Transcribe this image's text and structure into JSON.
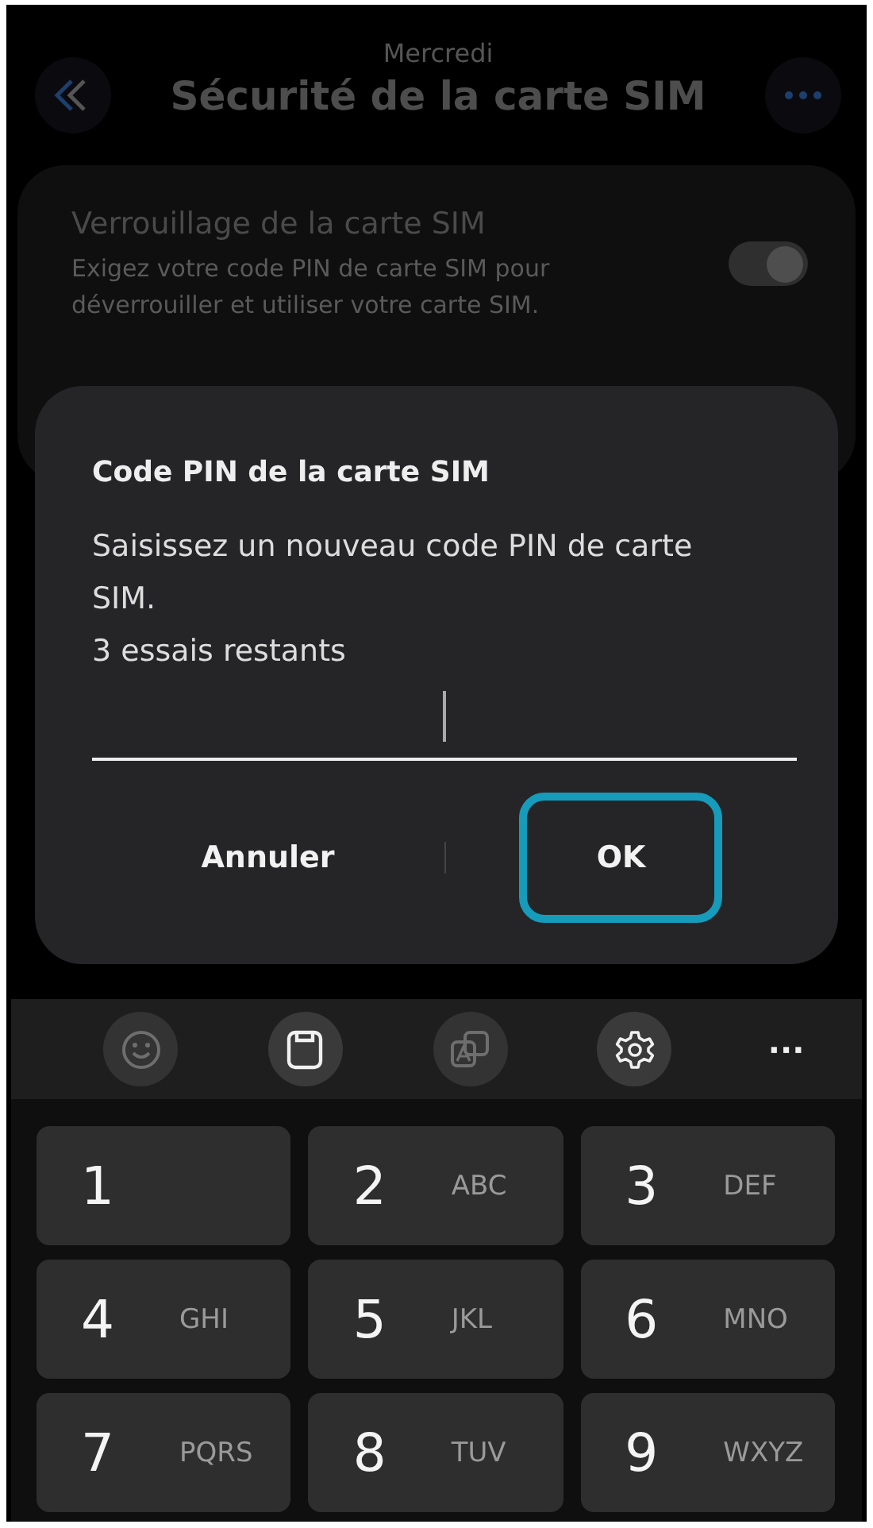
{
  "header": {
    "date": "Mercredi",
    "title": "Sécurité de la carte SIM"
  },
  "setting": {
    "title": "Verrouillage de la carte SIM",
    "description": "Exigez votre code PIN de carte SIM pour déverrouiller et utiliser votre carte SIM.",
    "on": true
  },
  "dialog": {
    "title": "Code PIN de la carte SIM",
    "message": "Saisissez un nouveau code PIN de carte SIM.",
    "attempts": "3 essais restants",
    "buttons": [
      {
        "label": "Annuler",
        "highlighted": false
      },
      {
        "label": "OK",
        "highlighted": true
      }
    ]
  },
  "keyboard_toolbar": [
    {
      "kind": "emoji",
      "disabled": true
    },
    {
      "kind": "clipboard",
      "disabled": false
    },
    {
      "kind": "translate",
      "disabled": true
    },
    {
      "kind": "settings",
      "disabled": false
    }
  ],
  "keyboard_more": "···",
  "keys": [
    {
      "digit": "1"
    },
    {
      "digit": "2",
      "letters": "ABC"
    },
    {
      "digit": "3",
      "letters": "DEF"
    },
    {
      "digit": "4",
      "letters": "GHI"
    },
    {
      "digit": "5",
      "letters": "JKL"
    },
    {
      "digit": "6",
      "letters": "MNO"
    },
    {
      "digit": "7",
      "letters": "PQRS"
    },
    {
      "digit": "8",
      "letters": "TUV"
    },
    {
      "digit": "9",
      "letters": "WXYZ"
    }
  ]
}
